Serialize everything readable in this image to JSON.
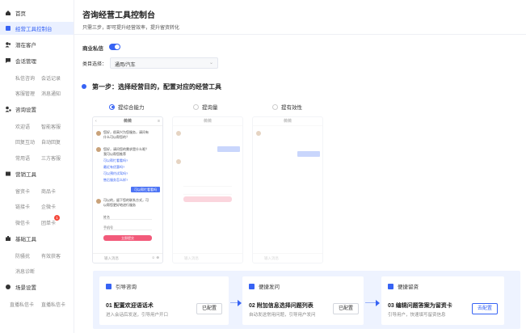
{
  "sidebar": {
    "items": [
      {
        "label": "首页",
        "icon": "home-icon"
      },
      {
        "label": "经营工具控制台",
        "icon": "console-icon",
        "active": true
      },
      {
        "label": "潜在客户",
        "icon": "users-icon"
      },
      {
        "label": "会话管理",
        "icon": "chat-icon"
      },
      {
        "label": "咨询设置",
        "icon": "person-gear-icon"
      },
      {
        "label": "营销工具",
        "icon": "marketing-icon"
      },
      {
        "label": "基础工具",
        "icon": "toolbox-icon"
      },
      {
        "label": "场景设置",
        "icon": "scene-icon"
      }
    ],
    "sub_items": {
      "session": [
        "私信咨询",
        "会话记录",
        "客服管理",
        "消息通知"
      ],
      "consult": [
        "欢迎语",
        "智能客服",
        "回复互动",
        "自动回复",
        "常用语",
        "三方客服"
      ],
      "marketing": [
        "留资卡",
        "商品卡",
        "链接卡",
        "企微卡",
        "微信卡",
        "团单卡"
      ],
      "basic": [
        "防骚扰",
        "有效获客",
        "消息诊断"
      ],
      "scene": [
        "直播私信卡",
        "直播私信卡"
      ]
    },
    "badge": "1"
  },
  "header": {
    "title": "咨询经营工具控制台",
    "subtitle": "只需三步，即可提升经营效率，提升留资转化"
  },
  "settings": {
    "commercial_dm_label": "商业私信",
    "category_label": "类目选择：",
    "category_value": "通用/汽车"
  },
  "step1": {
    "title": "第一步：选择经营目的，配置对应的经营工具",
    "options": [
      "提综合能力",
      "提询量",
      "提有效性"
    ],
    "selected": 0
  },
  "phones": [
    {
      "header": "薇薇",
      "greeting": "您好，很高兴为您服务，请问有什么可以帮您的？",
      "question": "您好，请问您的需求是什么呢？我可以帮您推荐",
      "links": [
        "可以帮忙看看吗?",
        "最近有优惠吗?",
        "可以预约试驾吗?",
        "售后服务怎么样?"
      ],
      "reply": "可以帮忙看看吗",
      "form_intro": "可以的，留下您的联系方式，可以帮您更好地进行服务",
      "form_fields": [
        "姓名",
        "手机号"
      ],
      "form_button": "立即提交",
      "input_placeholder": "输入消息"
    },
    {
      "header": "薇薇",
      "input_placeholder": "输入消息"
    },
    {
      "header": "薇薇",
      "input_placeholder": "输入消息"
    }
  ],
  "steps": [
    {
      "head": "引导咨询",
      "title": "01 配置欢迎语话术",
      "desc": "进入会话后发送，引导用户开口",
      "button": "已配置",
      "primary": false
    },
    {
      "head": "便捷发问",
      "title": "02 附加信息选择问题列表",
      "desc": "自动发送常用问题，引导用户发问",
      "button": "已配置",
      "primary": false
    },
    {
      "head": "便捷留资",
      "title": "03 编辑问题答案为留资卡",
      "desc": "引导用户，快速填写留资信息",
      "button": "去配置",
      "primary": true
    }
  ],
  "colors": {
    "accent": "#3763f4",
    "sidebar_active_bg": "#eaf0ff",
    "steps_bg": "#eef3ff",
    "form_button": "#f25a7a"
  }
}
